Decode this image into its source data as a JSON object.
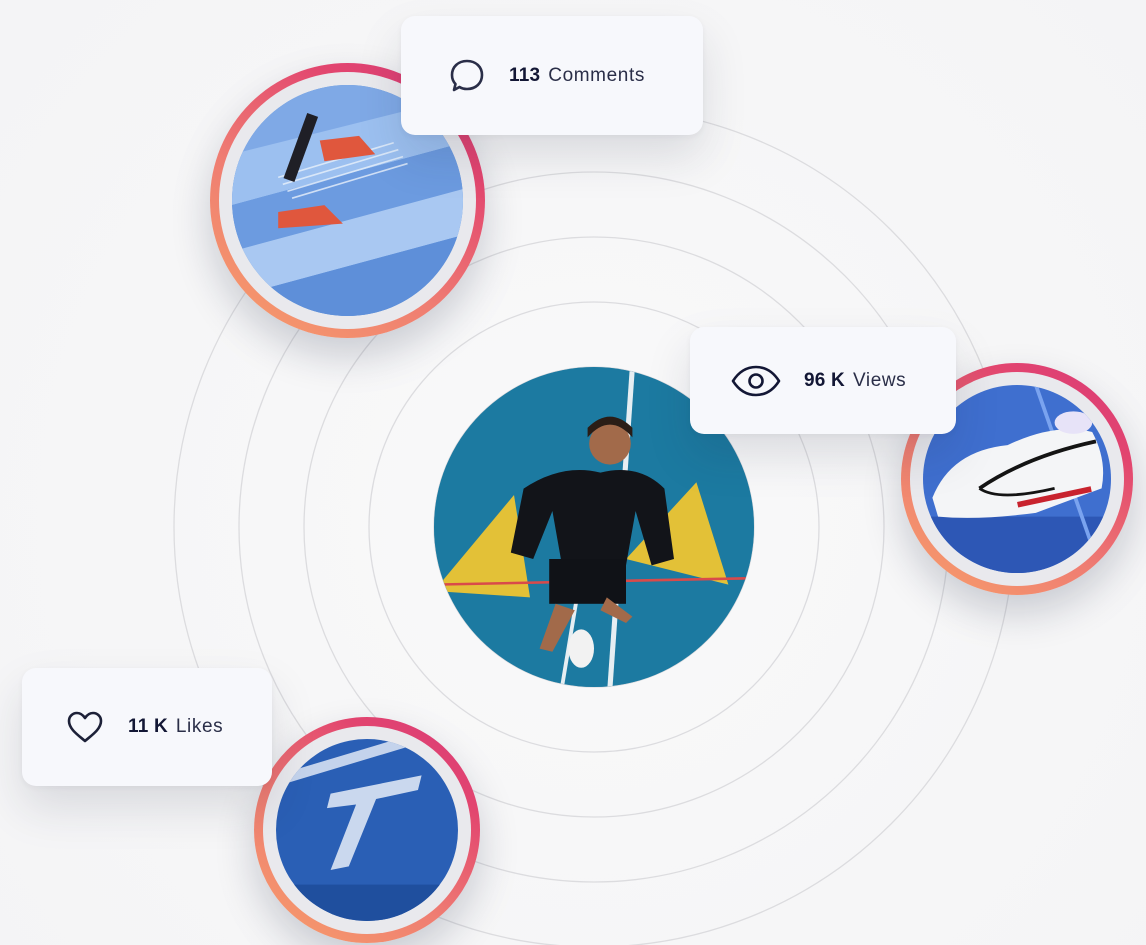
{
  "stats": {
    "comments": {
      "value": "113",
      "label": "Comments",
      "icon": "speech-bubble-icon"
    },
    "views": {
      "value": "96 K",
      "label": "Views",
      "icon": "eye-icon"
    },
    "likes": {
      "value": "11 K",
      "label": "Likes",
      "icon": "heart-icon"
    }
  },
  "photos": [
    {
      "name": "stairs-sneakers-photo",
      "subject": "red sneakers on blue stairs"
    },
    {
      "name": "white-sneaker-photo",
      "subject": "white sneaker"
    },
    {
      "name": "running-track-lane-photo",
      "subject": "track lane number 7"
    },
    {
      "name": "athlete-profile-photo",
      "subject": "man lying on blue track"
    }
  ],
  "colors": {
    "ring_gradient_start": "#f7a06a",
    "ring_gradient_end": "#d93a7a",
    "card_background": "#f7f8fc",
    "text_dark": "#131735"
  }
}
